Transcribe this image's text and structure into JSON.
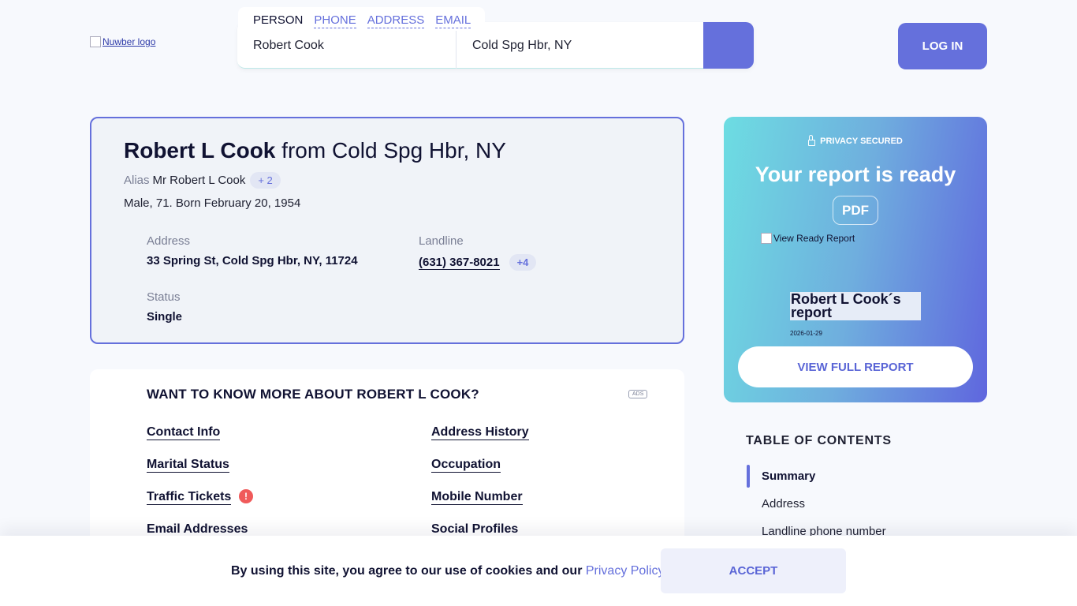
{
  "header": {
    "logo_alt": "Nuwber logo",
    "search_tabs": [
      "PERSON",
      "PHONE",
      "ADDRESS",
      "EMAIL"
    ],
    "name_value": "Robert Cook",
    "location_value": "Cold Spg Hbr, NY",
    "login_label": "LOG IN"
  },
  "profile": {
    "name": "Robert L Cook",
    "from_text": " from Cold Spg Hbr, NY",
    "alias_label": "Alias",
    "alias_name": "Mr Robert L Cook",
    "alias_more": "+ 2",
    "demographics": "Male, 71. Born February 20, 1954",
    "address_label": "Address",
    "address_value": "33 Spring St, Cold Spg Hbr, NY, 11724",
    "landline_label": "Landline",
    "landline_value": "(631) 367-8021",
    "landline_more": "+4",
    "status_label": "Status",
    "status_value": "Single"
  },
  "more": {
    "title": "WANT TO KNOW MORE ABOUT ROBERT L COOK?",
    "ads_label": "ADS",
    "links": {
      "contact_info": "Contact Info",
      "address_history": "Address History",
      "marital_status": "Marital Status",
      "occupation": "Occupation",
      "traffic_tickets": "Traffic Tickets",
      "mobile_number": "Mobile Number",
      "email_addresses": "Email Addresses",
      "social_profiles": "Social Profiles"
    },
    "warning_glyph": "!"
  },
  "report": {
    "secured": "PRIVACY SECURED",
    "ready": "Your report is ready",
    "pdf": "PDF",
    "img_alt": "View Ready Report",
    "title": "Robert L Cook´s report",
    "date": "2026-01-29",
    "view_full": "VIEW FULL REPORT"
  },
  "toc": {
    "title": "TABLE OF CONTENTS",
    "items": [
      "Summary",
      "Address",
      "Landline phone number"
    ]
  },
  "cookie": {
    "text": "By using this site, you agree to our use of cookies and our ",
    "link": "Privacy Policy",
    "end": ".",
    "accept": "ACCEPT"
  },
  "colors": {
    "accent": "#6570dc",
    "text": "#101232",
    "warning": "#f05a5a"
  }
}
